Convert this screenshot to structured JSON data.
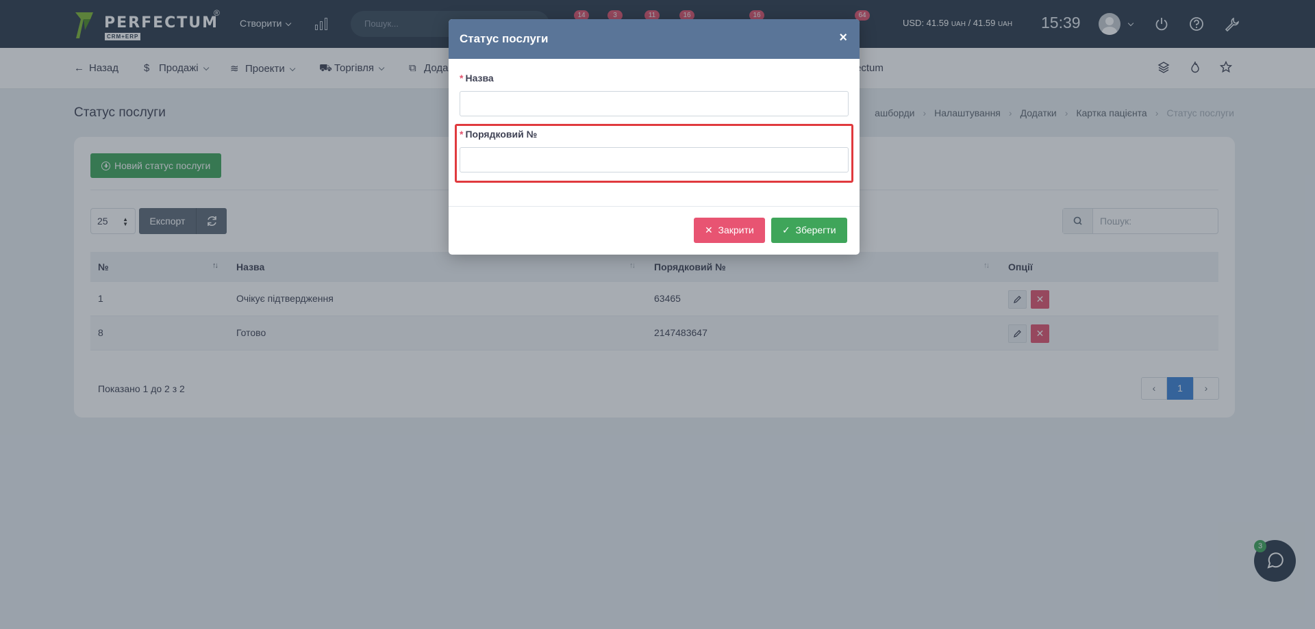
{
  "topbar": {
    "brand": "PERFECTUM",
    "brand_reg": "®",
    "brand_sub": "CRM+ERP",
    "create_label": "Створити",
    "search_placeholder": "Пошук...",
    "badges": [
      "14",
      "3",
      "11",
      "16",
      "16",
      "64"
    ],
    "currency_prefix": "USD: 41.59",
    "currency_unit1": "UAH",
    "currency_mid": " / 41.59",
    "currency_unit2": "UAH",
    "time": "15:39",
    "icons": [
      "chart-bars-icon",
      "power-icon",
      "help-icon",
      "wrench-icon"
    ]
  },
  "subnav": {
    "back": "Назад",
    "items": [
      "Продажі",
      "Проекти",
      "Торгівля",
      "Дода"
    ],
    "tail_text": "ectum",
    "icons": [
      "layers-icon",
      "fire-icon",
      "star-icon"
    ]
  },
  "page": {
    "title": "Статус послуги",
    "breadcrumb": [
      "ашборди",
      "Налаштування",
      "Додатки",
      "Картка пацієнта",
      "Статус послуги"
    ]
  },
  "toolbar": {
    "new_button": "Новий статус послуги",
    "page_size": "25",
    "export": "Експорт",
    "search_placeholder": "Пошук:"
  },
  "table": {
    "headers": [
      "№",
      "Назва",
      "Порядковий №",
      "Опції"
    ],
    "rows": [
      {
        "num": "1",
        "name": "Очікує підтвердження",
        "order": "63465"
      },
      {
        "num": "8",
        "name": "Готово",
        "order": "2147483647"
      }
    ]
  },
  "footer": {
    "shown": "Показано 1 до 2 з 2",
    "page": "1"
  },
  "chat": {
    "badge": "3"
  },
  "modal": {
    "title": "Статус послуги",
    "close_symbol": "×",
    "field_name_label": "Назва",
    "field_order_label": "Порядковий №",
    "required_mark": "*",
    "name_value": "",
    "order_value": "",
    "close_button": "Закрити",
    "save_button": "Зберегти"
  },
  "colors": {
    "topbar": "#2b3a4a",
    "modal_header": "#5a7598",
    "primary_green": "#3fa55a",
    "danger": "#e85472",
    "highlight": "#e03a3e",
    "pager_active": "#3b82d6"
  }
}
